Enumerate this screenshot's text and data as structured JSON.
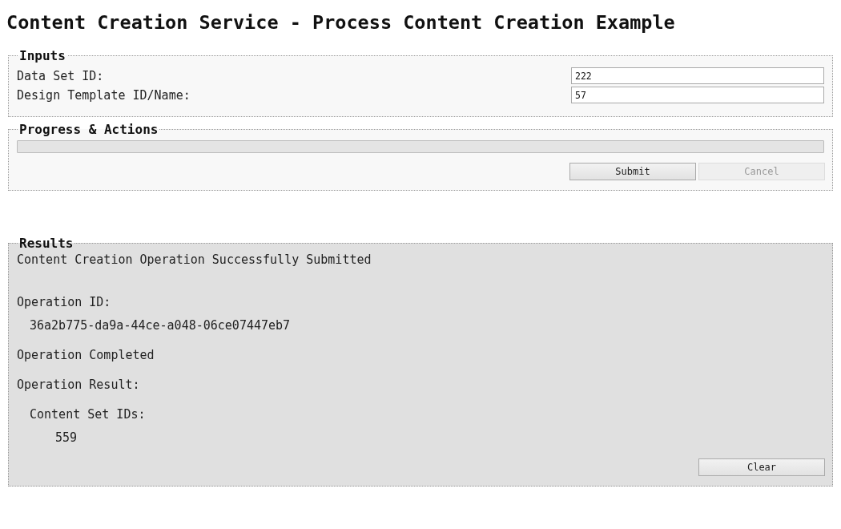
{
  "title": "Content Creation Service - Process Content Creation Example",
  "inputs": {
    "legend": "Inputs",
    "fields": [
      {
        "label": "Data Set ID:",
        "value": "222"
      },
      {
        "label": "Design Template ID/Name:",
        "value": "57"
      }
    ]
  },
  "progress": {
    "legend": "Progress & Actions",
    "level": 0,
    "buttons": [
      {
        "label": "Submit",
        "disabled": false
      },
      {
        "label": "Cancel",
        "disabled": true
      }
    ]
  },
  "results": {
    "legend": "Results",
    "message": "Content Creation Operation Successfully Submitted",
    "operation_id_label": "Operation ID:",
    "operation_id": "36a2b775-da9a-44ce-a048-06ce07447eb7",
    "status": "Operation Completed",
    "result_label": "Operation Result:",
    "result": {
      "label": "Content Set IDs:",
      "ids": [
        "559"
      ]
    },
    "clear_button": {
      "label": "Clear",
      "disabled": false
    }
  }
}
